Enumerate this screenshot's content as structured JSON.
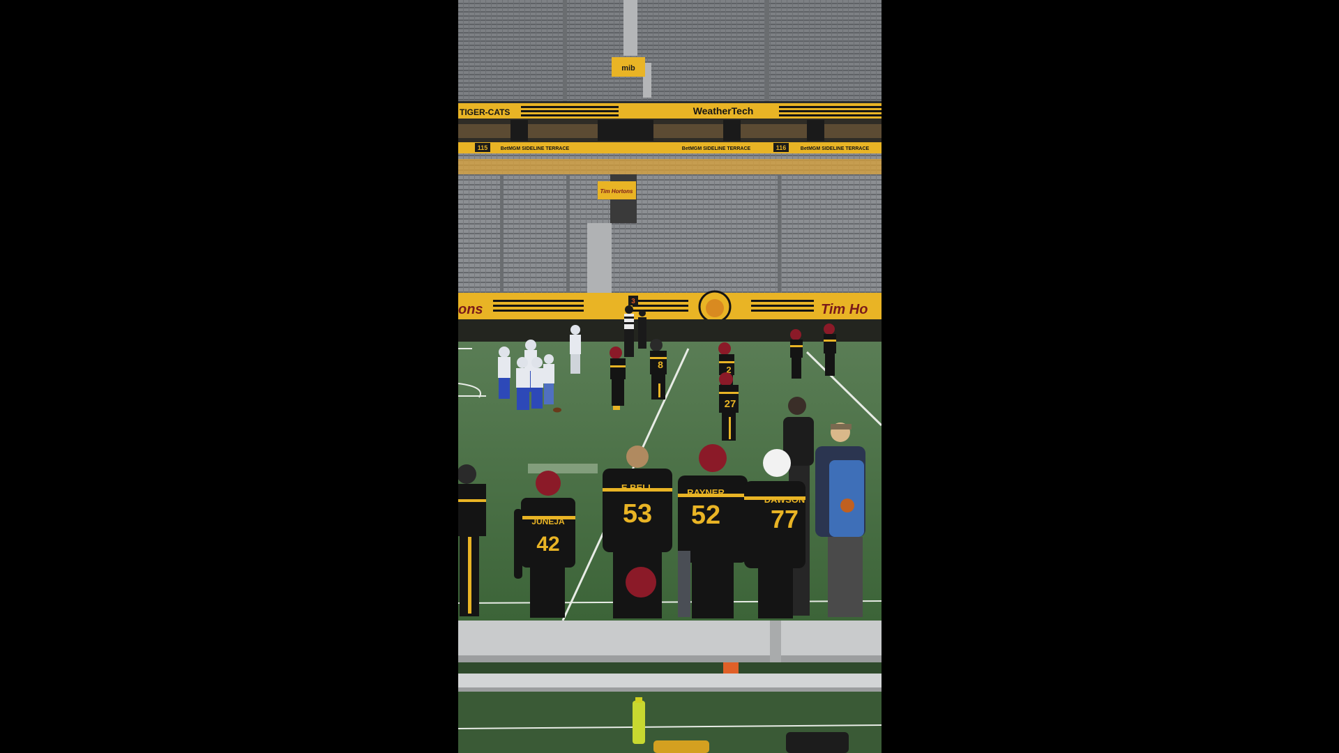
{
  "scene": {
    "description_free": true,
    "signs": {
      "top_sponsor": "mib",
      "banner_left": "TIGER-CATS",
      "banner_center": "WeatherTech",
      "section_left": "115",
      "section_right": "116",
      "terrace_1": "BetMGM SIDELINE TERRACE",
      "terrace_2": "BetMGM SIDELINE TERRACE",
      "terrace_3": "BetMGM SIDELINE TERRACE",
      "portal_sign": "Tim Hortons",
      "wall_right": "Tim Ho",
      "wall_left": "ons",
      "down_marker": "3"
    },
    "jerseys": {
      "j42_name": "JUNEJA",
      "j42_num": "42",
      "j53_name": "E.BELL",
      "j53_num": "53",
      "j52_name": "RAYNER",
      "j52_num": "52",
      "j77_name": "DAWSON",
      "j77_num": "77",
      "field_27": "27",
      "field_8": "8",
      "field_2": "2"
    },
    "colors": {
      "gold": "#e9b425",
      "black": "#141414",
      "turf": "#3f6b3a",
      "seats": "#8a8d90",
      "maroon": "#8b1a28"
    }
  }
}
